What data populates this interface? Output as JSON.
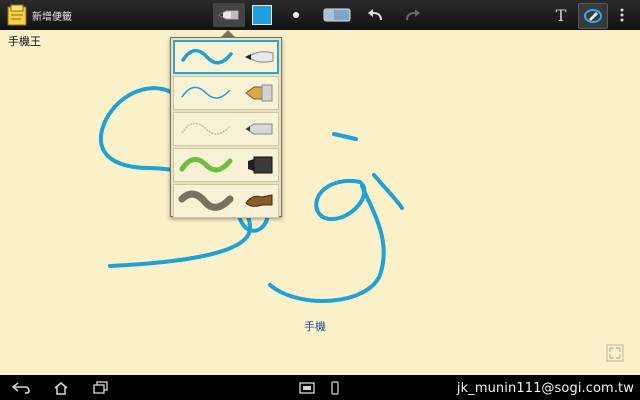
{
  "app": {
    "title": "新增便籤"
  },
  "note": {
    "title": "手機王",
    "caption": "手機"
  },
  "toolbar": {
    "tools": [
      {
        "name": "pen-tool-icon"
      },
      {
        "name": "color-swatch",
        "color": "#1f9fd9"
      },
      {
        "name": "pen-size-icon"
      },
      {
        "name": "eraser-icon"
      },
      {
        "name": "undo-icon"
      },
      {
        "name": "redo-icon"
      },
      {
        "name": "text-mode-icon",
        "label": "T"
      },
      {
        "name": "draw-mode-icon"
      },
      {
        "name": "menu-icon"
      }
    ]
  },
  "pen_styles": [
    {
      "name": "brush",
      "stroke_color": "#1f9fd9"
    },
    {
      "name": "fountain-pen",
      "stroke_color": "#1f9fd9"
    },
    {
      "name": "pencil",
      "stroke_color": "#c9bf9c"
    },
    {
      "name": "marker",
      "stroke_color": "#6cbf3a"
    },
    {
      "name": "calligraphy-brush",
      "stroke_color": "#7a7160"
    }
  ],
  "colors": {
    "ink": "#1f9fd9",
    "paper": "#fbf1c9"
  },
  "navbar": {
    "buttons": [
      {
        "name": "back-icon"
      },
      {
        "name": "home-icon"
      },
      {
        "name": "recent-apps-icon"
      },
      {
        "name": "screenshot-icon"
      },
      {
        "name": "app-icon"
      }
    ]
  },
  "watermark": "jk_munin111@sogi.com.tw"
}
